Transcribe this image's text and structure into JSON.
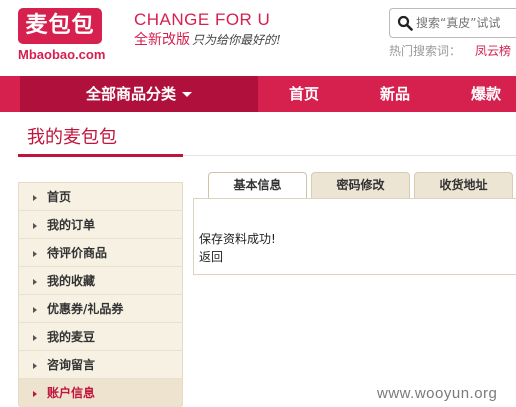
{
  "header": {
    "logo_text": "麦包包",
    "logo_domain": "Mbaobao.com",
    "slogan_en": "CHANGE FOR U",
    "slogan_cn": "全新改版",
    "slogan_script": "只为给你最好的!",
    "search_placeholder": "搜索“真皮”试试",
    "hot_label": "热门搜索词：",
    "hot_link": "凤云榜"
  },
  "nav": {
    "all_categories": "全部商品分类",
    "items": [
      "首页",
      "新品",
      "爆款"
    ]
  },
  "page": {
    "title": "我的麦包包"
  },
  "sidebar": {
    "items": [
      {
        "label": "首页"
      },
      {
        "label": "我的订单"
      },
      {
        "label": "待评价商品"
      },
      {
        "label": "我的收藏"
      },
      {
        "label": "优惠券/礼品券"
      },
      {
        "label": "我的麦豆"
      },
      {
        "label": "咨询留言"
      },
      {
        "label": "账户信息"
      }
    ],
    "active_index": 7
  },
  "tabs": [
    "基本信息",
    "密码修改",
    "收货地址"
  ],
  "content": {
    "message": "保存资料成功!",
    "back": "返回"
  },
  "watermark": "www.wooyun.org",
  "colors": {
    "brand": "#d6204e",
    "nav_dark": "#b0113c",
    "sidebar_bg": "#f7f1e4"
  }
}
